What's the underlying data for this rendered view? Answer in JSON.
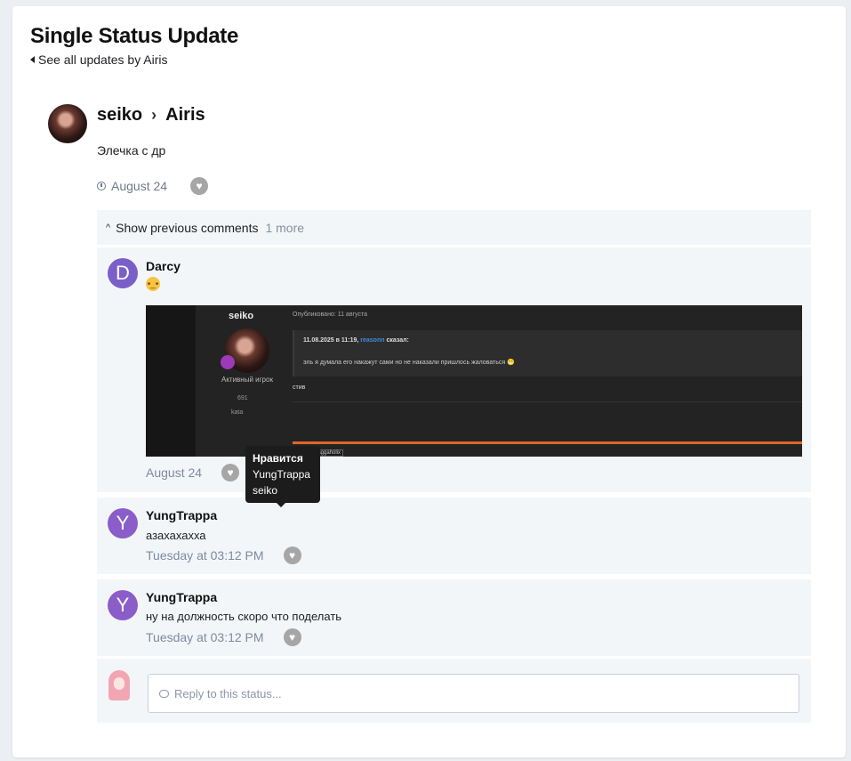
{
  "page": {
    "title": "Single Status Update",
    "back_link": "See all updates by Airis"
  },
  "status": {
    "author": "seiko",
    "target": "Airis",
    "text": "Элечка с др",
    "date": "August 24"
  },
  "comments_section": {
    "show_previous": "Show previous comments",
    "more_count": "1 more",
    "comments": [
      {
        "initial": "D",
        "avatar_color": "#7b5fc9",
        "author": "Darcy",
        "emoji": "🤨",
        "date": "August 24",
        "reaction_count": "2",
        "tooltip": {
          "title": "Нравится",
          "users": [
            "YungTrappa",
            "seiko"
          ]
        },
        "screenshot": {
          "user": "seiko",
          "role": "Активный игрок",
          "count": "691",
          "short": "kata",
          "published": "Опубликовано: 11 августа",
          "quote_head_date": "11.08.2025 в 11:19,",
          "quote_head_user": "reasonn",
          "quote_head_said": "сказал:",
          "quote_body": "эль я думала его накажут сами но не наказали пришлось жаловаться 😁",
          "tail": "стив",
          "tag": "swaggaholix"
        }
      },
      {
        "initial": "Y",
        "avatar_color": "#8a5dc9",
        "author": "YungTrappa",
        "text": "азахахахха",
        "date": "Tuesday at 03:12 PM"
      },
      {
        "initial": "Y",
        "avatar_color": "#8a5dc9",
        "author": "YungTrappa",
        "text": "ну на должность скоро что поделать",
        "date": "Tuesday at 03:12 PM"
      }
    ],
    "reply_placeholder": "Reply to this status..."
  },
  "colors": {
    "accent": "#3a7ac4",
    "page_bg": "#ebeef2",
    "comment_bg": "#f3f6f9"
  }
}
